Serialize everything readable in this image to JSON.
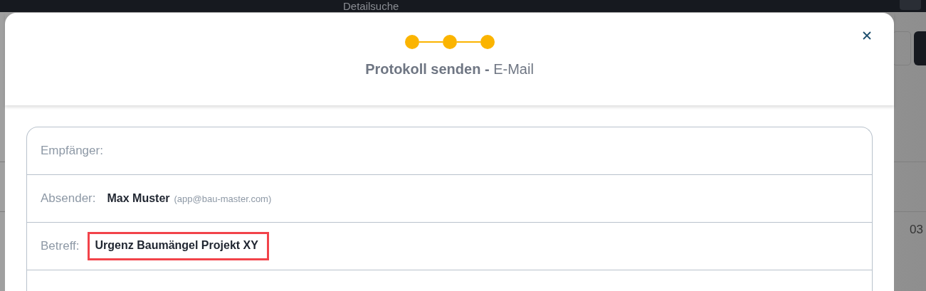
{
  "background": {
    "title": "Detailsuche",
    "cell": "03"
  },
  "dialog": {
    "steps": [
      {
        "done": true
      },
      {
        "done": true
      },
      {
        "done": true
      }
    ],
    "title": {
      "bold": "Protokoll senden -",
      "light": "E-Mail"
    },
    "fields": [
      {
        "label": "Empfänger:"
      },
      {
        "label": "Absender:",
        "name": "Max Muster",
        "email": "(app@bau-master.com)"
      },
      {
        "label": "Betreff:",
        "value": "Urgenz Baumängel Projekt XY",
        "highlighted": true
      }
    ]
  }
}
